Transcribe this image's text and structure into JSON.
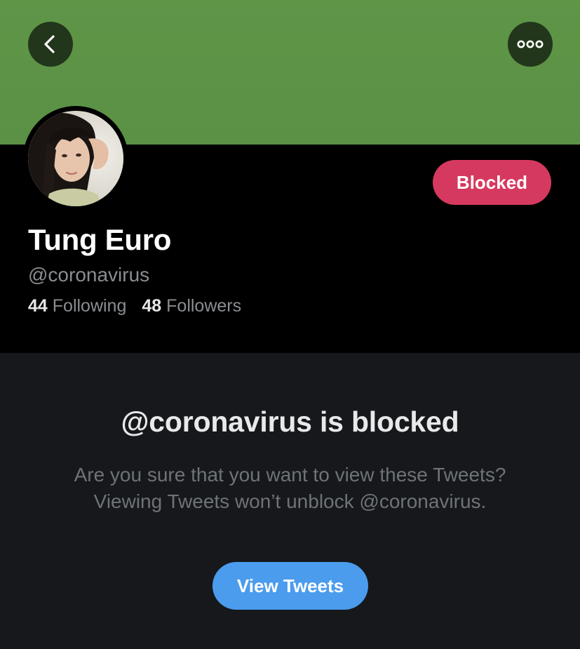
{
  "colors": {
    "banner": "#5d9346",
    "header_button_bg": "#22361b",
    "blocked_button": "#d6395f",
    "view_tweets_button": "#4b9ced",
    "panel_bg": "#16181c",
    "secondary_text": "#8a8d91"
  },
  "header": {
    "back_icon": "chevron-left-icon",
    "more_icon": "ellipsis-icon"
  },
  "profile": {
    "display_name": "Tung Euro",
    "handle": "@coronavirus",
    "following_count": "44",
    "following_label": "Following",
    "followers_count": "48",
    "followers_label": "Followers",
    "blocked_button_label": "Blocked"
  },
  "blocked_notice": {
    "title": "@coronavirus is blocked",
    "message": "Are you sure that you want to view these Tweets? Viewing Tweets won’t unblock @coronavirus.",
    "view_button_label": "View Tweets"
  }
}
